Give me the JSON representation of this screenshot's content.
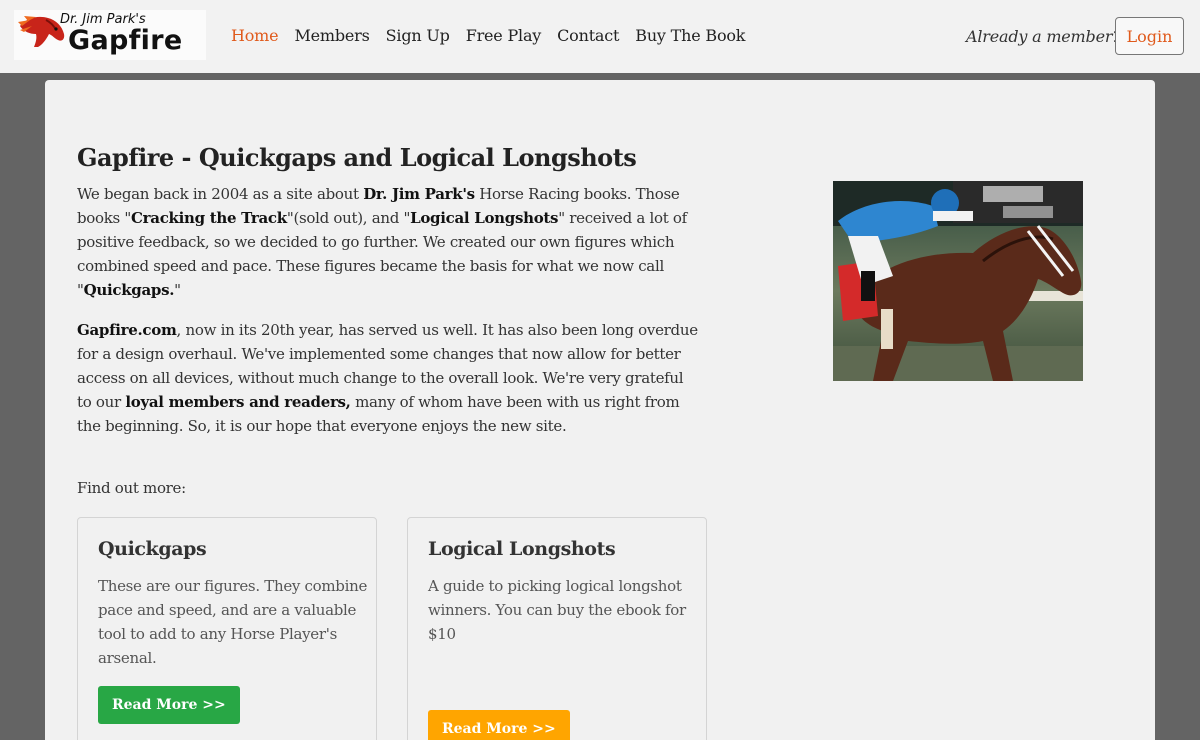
{
  "header": {
    "logo_small": "Dr. Jim Park's",
    "logo_big": "Gapfire",
    "nav": [
      {
        "label": "Home"
      },
      {
        "label": "Members"
      },
      {
        "label": "Sign Up"
      },
      {
        "label": "Free Play"
      },
      {
        "label": "Contact"
      },
      {
        "label": "Buy The Book"
      }
    ],
    "member_question": "Already a member?",
    "login_label": "Login"
  },
  "main": {
    "title_bold": "Gapfire",
    "title_rest": " - Quickgaps and Logical Longshots",
    "p1": {
      "a": "We began back in 2004 as a site about ",
      "b": "Dr. Jim Park's",
      "c": " Horse Racing books. Those books \"",
      "d": "Cracking the Track",
      "e": "\"(sold out), and \"",
      "f": "Logical Longshots",
      "g": "\" received a lot of positive feedback, so we decided to go further. We created our own figures which combined speed and pace. These figures became the basis for what we now call \"",
      "h": "Quickgaps.",
      "i": "\""
    },
    "p2": {
      "a": "Gapfire.com",
      "b": ", now in its 20th year, has served us well. It has also been long overdue for a design overhaul. We've implemented some changes that now allow for better access on all devices, without much change to the overall look. We're very grateful to our ",
      "c": "loyal members and readers,",
      "d": " many of whom have been with us right from the beginning. So, it is our hope that everyone enjoys the new site."
    },
    "find_out": "Find out more:",
    "cards": [
      {
        "title": "Quickgaps",
        "text": "These are our figures. They combine pace and speed, and are a valuable tool to add to any Horse Player's arsenal.",
        "button": "Read More >>"
      },
      {
        "title": "Logical Longshots",
        "text": "  A guide to picking logical longshot\n winners. You can buy the ebook for $10",
        "button": "Read More >>"
      }
    ]
  },
  "colors": {
    "accent": "#e05a1c",
    "green_button": "#28a745",
    "orange_button": "#ffa500",
    "backdrop": "#646464",
    "panel": "#f1f1f1"
  },
  "icons": {
    "logo": "horse-head-icon"
  }
}
